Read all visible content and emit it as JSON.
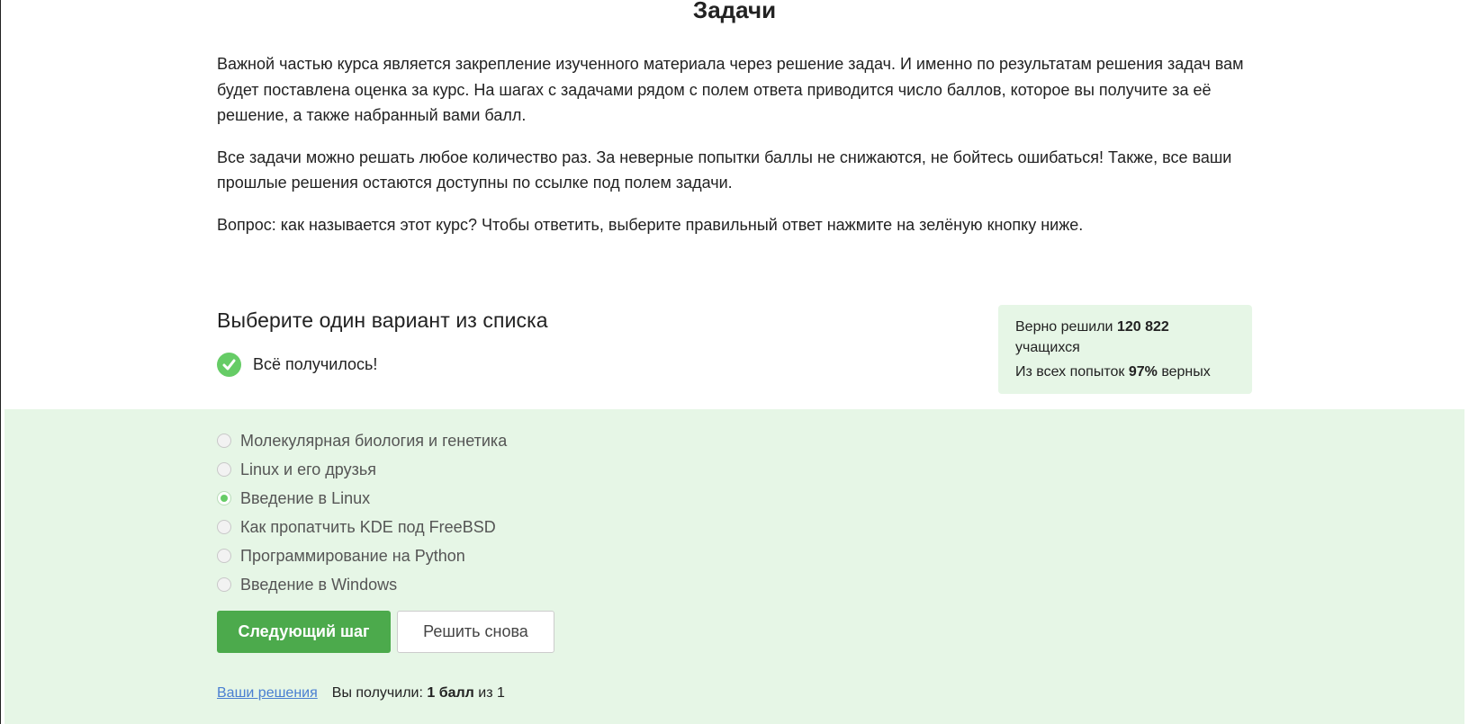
{
  "page": {
    "title": "Задачи"
  },
  "intro": {
    "paragraph1": "Важной частью курса является закрепление изученного материала через решение задач. И именно по результатам решения задач вам будет поставлена оценка за курс. На шагах с задачами рядом с полем ответа приводится число баллов, которое вы получите за её решение, а также набранный вами балл.",
    "paragraph2": "Все задачи можно решать любое количество раз. За неверные попытки баллы не снижаются, не бойтесь ошибаться! Также, все ваши прошлые решения остаются доступны по ссылке под полем задачи.",
    "paragraph3": "Вопрос: как называется этот курс? Чтобы ответить, выберите правильный ответ нажмите на зелёную кнопку ниже."
  },
  "quiz": {
    "heading": "Выберите один вариант из списка",
    "success_message": "Всё получилось!",
    "options": [
      {
        "label": "Молекулярная биология и генетика",
        "selected": false
      },
      {
        "label": "Linux и его друзья",
        "selected": false
      },
      {
        "label": "Введение в Linux",
        "selected": true
      },
      {
        "label": "Как пропатчить KDE под FreeBSD",
        "selected": false
      },
      {
        "label": "Программирование на Python",
        "selected": false
      },
      {
        "label": "Введение в Windows",
        "selected": false
      }
    ],
    "next_button": "Следующий шаг",
    "retry_button": "Решить снова"
  },
  "stats": {
    "solved_prefix": "Верно решили",
    "solved_count": "120 822",
    "solved_suffix": "учащихся",
    "attempts_prefix": "Из всех попыток",
    "attempts_percent": "97%",
    "attempts_suffix": "верных"
  },
  "footer": {
    "solutions_link": "Ваши решения",
    "score_prefix": "Вы получили:",
    "score_value": "1 балл",
    "score_suffix": "из 1"
  },
  "colors": {
    "accent_green": "#4caa4c",
    "success_green": "#66cc66",
    "panel_green": "#e6f6e6",
    "link_blue": "#4a7fd1"
  },
  "icons": {
    "success": "check-circle-icon",
    "radio": "radio-button-icon"
  }
}
